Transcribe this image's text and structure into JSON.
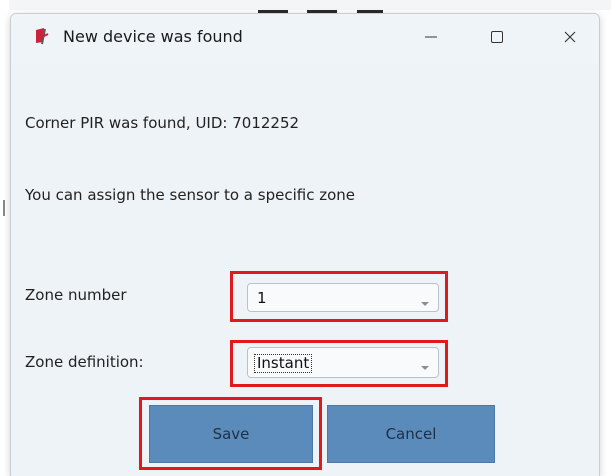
{
  "window": {
    "title": "New device was found",
    "controls": {
      "minimize_icon": "minimize-icon",
      "maximize_icon": "maximize-icon",
      "close_icon": "close-icon"
    }
  },
  "body": {
    "found_message": "Corner PIR was found, UID: 7012252",
    "assign_message": "You can assign the sensor to a specific zone"
  },
  "form": {
    "zone_number_label": "Zone number",
    "zone_number_value": "1",
    "zone_definition_label": "Zone definition:",
    "zone_definition_value": "Instant"
  },
  "buttons": {
    "save_label": "Save",
    "cancel_label": "Cancel"
  },
  "colors": {
    "highlight": "#e0191c",
    "button_fill": "#5b8bbb",
    "titlebar": "#eff4f9",
    "content_bg": "#eef3f7"
  }
}
